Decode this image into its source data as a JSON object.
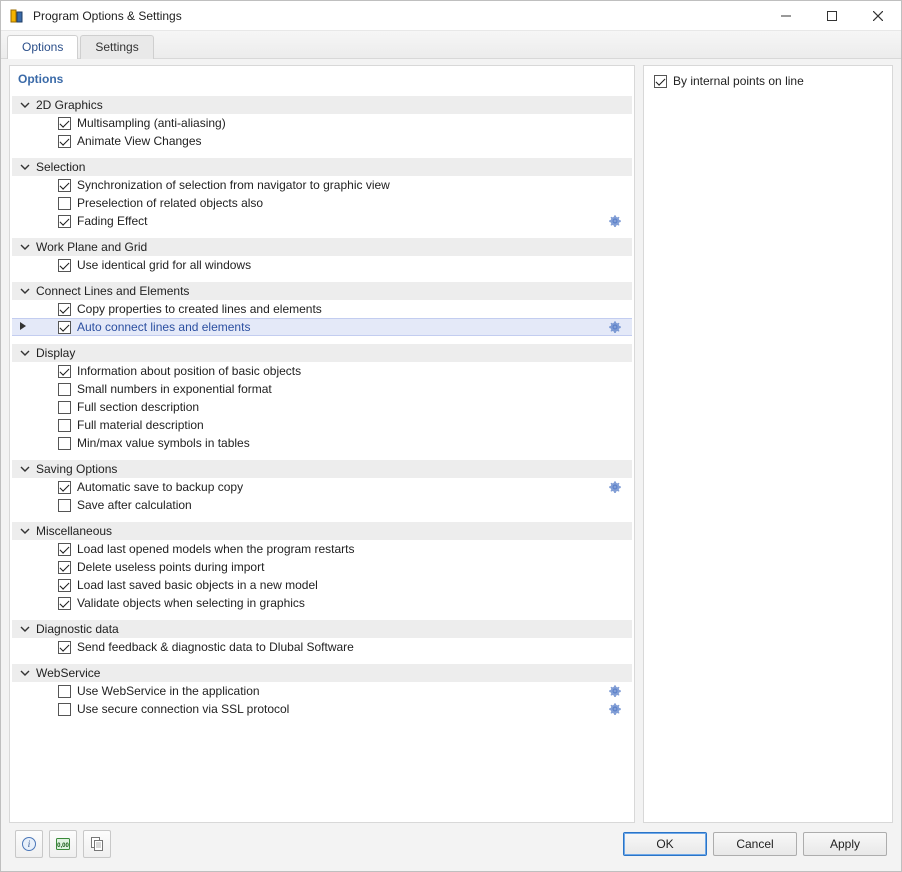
{
  "window": {
    "title": "Program Options & Settings"
  },
  "tabs": {
    "options": "Options",
    "settings": "Settings",
    "active": "options"
  },
  "panel_title": "Options",
  "right_panel": {
    "by_internal_points": {
      "label": "By internal points on line",
      "checked": true
    }
  },
  "groups": [
    {
      "id": "2d-graphics",
      "label": "2D Graphics",
      "items": [
        {
          "id": "multisampling",
          "label": "Multisampling (anti-aliasing)",
          "checked": true
        },
        {
          "id": "animate-view",
          "label": "Animate View Changes",
          "checked": true
        }
      ]
    },
    {
      "id": "selection",
      "label": "Selection",
      "items": [
        {
          "id": "sync-selection",
          "label": "Synchronization of selection from navigator to graphic view",
          "checked": true
        },
        {
          "id": "preselection",
          "label": "Preselection of related objects also",
          "checked": false
        },
        {
          "id": "fading-effect",
          "label": "Fading Effect",
          "checked": true,
          "gear": true
        }
      ]
    },
    {
      "id": "work-plane",
      "label": "Work Plane and Grid",
      "items": [
        {
          "id": "identical-grid",
          "label": "Use identical grid for all windows",
          "checked": true
        }
      ]
    },
    {
      "id": "connect",
      "label": "Connect Lines and Elements",
      "items": [
        {
          "id": "copy-props",
          "label": "Copy properties to created lines and elements",
          "checked": true
        },
        {
          "id": "auto-connect",
          "label": "Auto connect lines and elements",
          "checked": true,
          "gear": true,
          "selected": true
        }
      ]
    },
    {
      "id": "display",
      "label": "Display",
      "items": [
        {
          "id": "info-position",
          "label": "Information about position of basic objects",
          "checked": true
        },
        {
          "id": "small-numbers",
          "label": "Small numbers in exponential format",
          "checked": false
        },
        {
          "id": "full-section",
          "label": "Full section description",
          "checked": false
        },
        {
          "id": "full-material",
          "label": "Full material description",
          "checked": false
        },
        {
          "id": "minmax",
          "label": "Min/max value symbols in tables",
          "checked": false
        }
      ]
    },
    {
      "id": "saving",
      "label": "Saving Options",
      "items": [
        {
          "id": "auto-backup",
          "label": "Automatic save to backup copy",
          "checked": true,
          "gear": true
        },
        {
          "id": "save-after-calc",
          "label": "Save after calculation",
          "checked": false
        }
      ]
    },
    {
      "id": "misc",
      "label": "Miscellaneous",
      "items": [
        {
          "id": "load-last-models",
          "label": "Load last opened models when the program restarts",
          "checked": true
        },
        {
          "id": "delete-useless",
          "label": "Delete useless points during import",
          "checked": true
        },
        {
          "id": "load-last-basic",
          "label": "Load last saved basic objects in a new model",
          "checked": true
        },
        {
          "id": "validate-objects",
          "label": "Validate objects when selecting in graphics",
          "checked": true
        }
      ]
    },
    {
      "id": "diagnostic",
      "label": "Diagnostic data",
      "items": [
        {
          "id": "send-feedback",
          "label": "Send feedback & diagnostic data to Dlubal Software",
          "checked": true
        }
      ]
    },
    {
      "id": "webservice",
      "label": "WebService",
      "items": [
        {
          "id": "use-webservice",
          "label": "Use WebService in the application",
          "checked": false,
          "gear": true
        },
        {
          "id": "use-ssl",
          "label": "Use secure connection via SSL protocol",
          "checked": false,
          "gear": true
        }
      ]
    }
  ],
  "buttons": {
    "ok": "OK",
    "cancel": "Cancel",
    "apply": "Apply"
  }
}
